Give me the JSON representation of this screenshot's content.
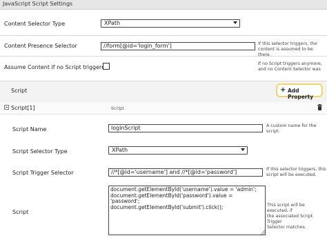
{
  "window": {
    "title": "JavaScript Script Settings"
  },
  "fields": {
    "content_selector_type": {
      "label": "Content Selector Type",
      "value": "XPath"
    },
    "content_presence_selector": {
      "label": "Content Presence Selector",
      "value": "//form[@id='login_form']",
      "help": [
        "If this selector triggers, the",
        "content is assumed to be there."
      ]
    },
    "assume_content": {
      "label": "Assume Content if no Script triggered",
      "checked": false,
      "help": [
        "If no Script triggers anymore,",
        "and no Content Selector was"
      ]
    }
  },
  "script_section": {
    "label": "Script",
    "add_button": "Add Property"
  },
  "script_item": {
    "header": "Script[1]",
    "type_label": "Script",
    "name": {
      "label": "Script Name",
      "value": "loginScript",
      "help": [
        "A custom name for the",
        "script."
      ]
    },
    "selector_type": {
      "label": "Script Selector Type",
      "value": "XPath"
    },
    "trigger_selector": {
      "label": "Script Trigger Selector",
      "value": "//*[@id='username'] and //*[@id='password']",
      "help": [
        "If this selector triggers, this",
        "script will be executed."
      ]
    },
    "script": {
      "label": "Script",
      "lines": [
        "document.getElementById('username').value = 'admin';",
        "document.getElementById('password').value =",
        "'password';",
        "document.getElementById('submit').click();"
      ],
      "help": [
        "This script will be executed, if",
        "the associated Script Trigger",
        "Selector matches."
      ]
    }
  },
  "icons": {
    "add": "plus-icon",
    "delete": "trash-icon",
    "collapse": "collapse-minus-icon"
  }
}
